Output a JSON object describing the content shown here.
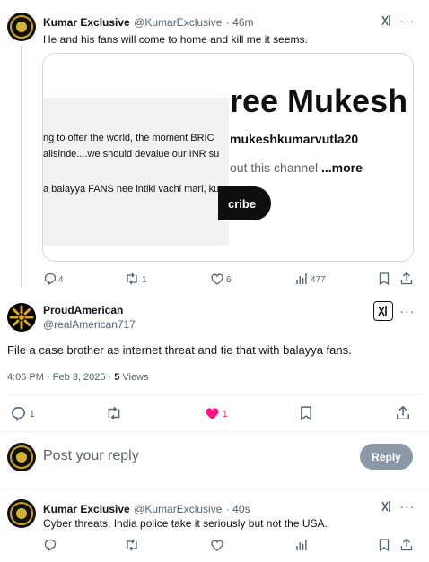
{
  "post1": {
    "name": "Kumar Exclusive",
    "handle": "@KumarExclusive",
    "time": "· 46m",
    "text": "He and his fans will come to home and kill me it seems.",
    "card": {
      "title": "ree Mukesh",
      "handle": "mukeshkumarvutla20",
      "about": "out this channel",
      "more": "...more",
      "subscribe": "cribe",
      "line1": "ng to offer the world, the moment BRIC",
      "line2": "alisinde....we should devalue our INR su",
      "line3": "a balayya FANS nee intiki vachi mari, ku"
    },
    "stats": {
      "replies": "4",
      "reposts": "1",
      "likes": "6",
      "views": "477"
    }
  },
  "post2": {
    "name": "ProudAmerican",
    "handle": "@realAmerican717",
    "text": "File a case brother as internet threat and tie that with balayya fans.",
    "timestamp": "4:06 PM · Feb 3, 2025 · ",
    "views_count": "5",
    "views_label": " Views",
    "stats": {
      "replies": "1",
      "likes": "1"
    }
  },
  "reply_box": {
    "placeholder": "Post your reply",
    "button": "Reply"
  },
  "post3": {
    "name": "Kumar Exclusive",
    "handle": "@KumarExclusive",
    "time": "· 40s",
    "text": "Cyber threats, India police take it seriously but not the USA."
  },
  "colors": {
    "like_active": "#f91880",
    "muted": "#536471",
    "reply_button": "#8b98a5"
  }
}
